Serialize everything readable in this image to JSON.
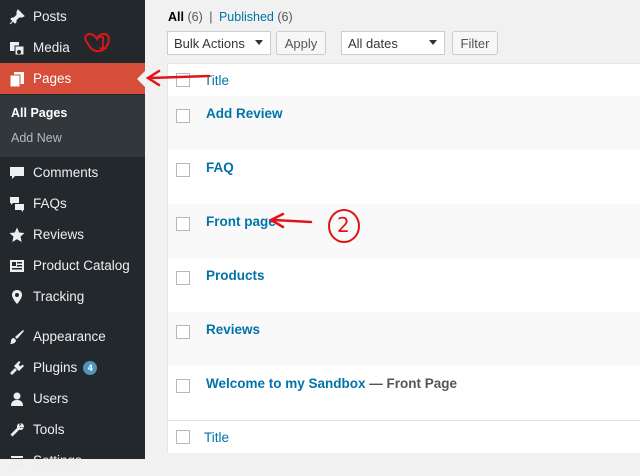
{
  "sidebar": {
    "items": [
      {
        "label": "Posts",
        "icon": "pin-icon"
      },
      {
        "label": "Media",
        "icon": "media-icon"
      },
      {
        "label": "Pages",
        "icon": "pages-icon"
      },
      {
        "label": "Comments",
        "icon": "comments-icon"
      },
      {
        "label": "FAQs",
        "icon": "faqs-icon"
      },
      {
        "label": "Reviews",
        "icon": "star-icon"
      },
      {
        "label": "Product Catalog",
        "icon": "catalog-icon"
      },
      {
        "label": "Tracking",
        "icon": "location-icon"
      },
      {
        "label": "Appearance",
        "icon": "brush-icon"
      },
      {
        "label": "Plugins",
        "icon": "plugin-icon",
        "badge": "4"
      },
      {
        "label": "Users",
        "icon": "user-icon"
      },
      {
        "label": "Tools",
        "icon": "wrench-icon"
      },
      {
        "label": "Settings",
        "icon": "settings-icon"
      }
    ],
    "submenu": [
      "All Pages",
      "Add New"
    ]
  },
  "filters": {
    "all_label": "All",
    "all_count": "(6)",
    "separator": "|",
    "published_label": "Published",
    "published_count": "(6)",
    "bulk_actions": "Bulk Actions",
    "apply": "Apply",
    "dates": "All dates",
    "filter": "Filter"
  },
  "table": {
    "column_title": "Title",
    "rows": [
      {
        "title": "Add Review",
        "state": ""
      },
      {
        "title": "FAQ",
        "state": ""
      },
      {
        "title": "Front page",
        "state": ""
      },
      {
        "title": "Products",
        "state": ""
      },
      {
        "title": "Reviews",
        "state": ""
      },
      {
        "title": "Welcome to my Sandbox",
        "state": " — Front Page"
      }
    ]
  },
  "annotations": {
    "one": "1",
    "two": "2",
    "color": "#e0151a"
  },
  "colors": {
    "sidebar_bg": "#23282d",
    "current_menu": "#d64e3a",
    "link": "#0073aa"
  }
}
